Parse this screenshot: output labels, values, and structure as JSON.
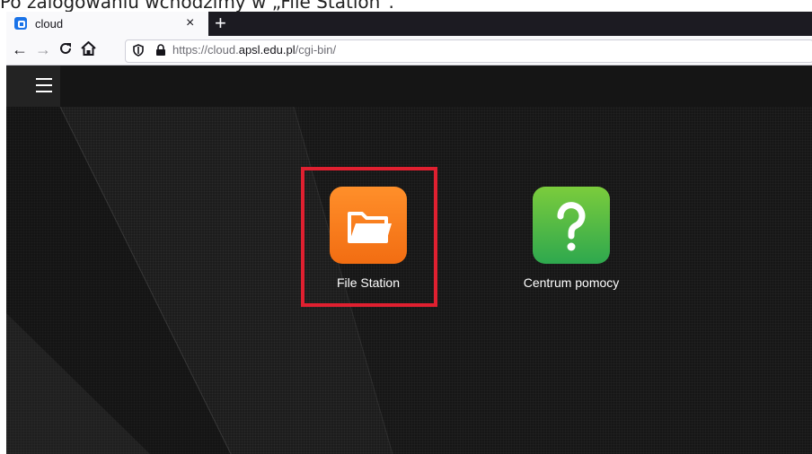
{
  "caption": "Po zalogowaniu wchodzimy w „File Station”.",
  "browser": {
    "tab_title": "cloud",
    "tab_close": "×",
    "new_tab": "+",
    "url_prefix": "https://cloud.",
    "url_domain": "apsl.edu.pl",
    "url_path": "/cgi-bin/"
  },
  "desktop": {
    "apps": [
      {
        "label": "File Station",
        "icon": "folder-icon",
        "color": "#f57a1f"
      },
      {
        "label": "Centrum pomocy",
        "icon": "help-question-icon",
        "color": "#3aae4a"
      }
    ],
    "highlight_color": "#e02030"
  }
}
